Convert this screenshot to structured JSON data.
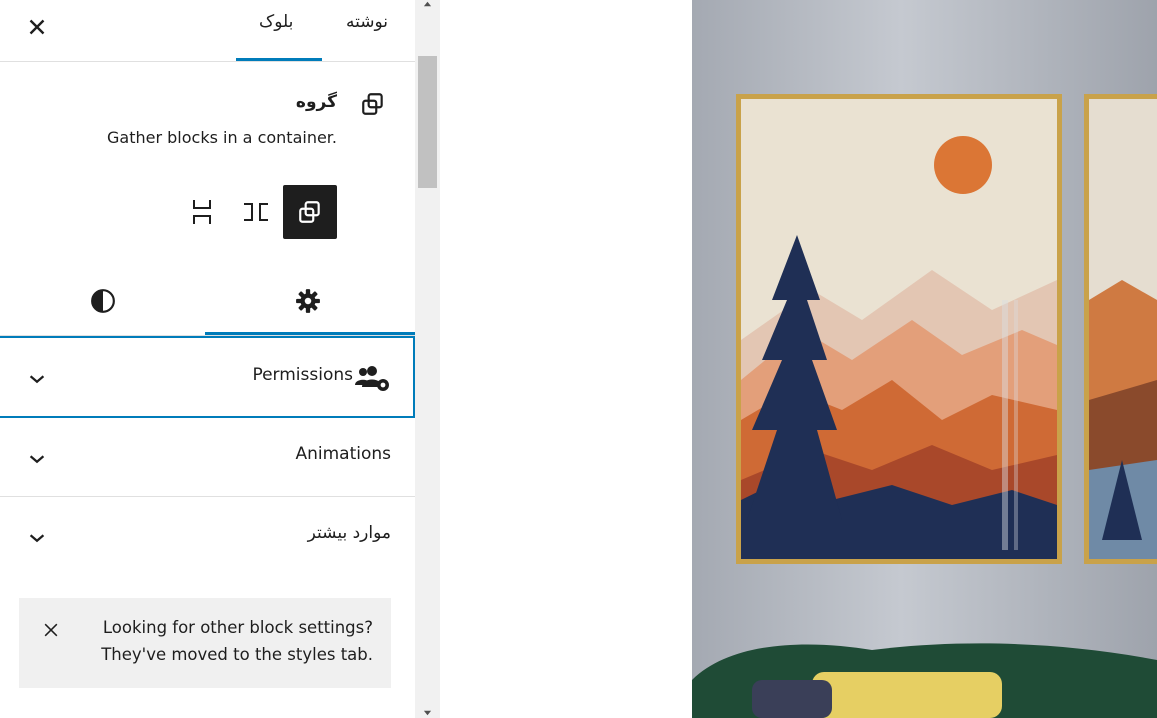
{
  "tabs": {
    "post": "نوشته",
    "block": "بلوک"
  },
  "block_card": {
    "title": "گروه",
    "description": "Gather blocks in a container."
  },
  "variations": [
    "group",
    "row",
    "stack"
  ],
  "inspector_tabs": [
    "settings",
    "styles"
  ],
  "panels": {
    "permissions": "Permissions",
    "animations": "Animations",
    "more": "موارد بیشتر"
  },
  "notice": {
    "line1": "Looking for other block settings?",
    "line2": "They've moved to the styles tab."
  },
  "colors": {
    "accent": "#007cba",
    "dark": "#1e1e1e",
    "notice_bg": "#f0f0f0"
  },
  "icons": [
    "close-icon",
    "group-icon",
    "row-icon",
    "stack-icon",
    "settings-gear-icon",
    "styles-half-circle-icon",
    "permissions-users-gear-icon",
    "chevron-down-icon"
  ]
}
